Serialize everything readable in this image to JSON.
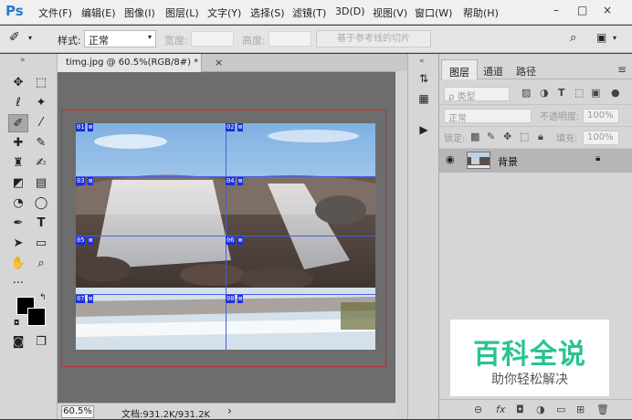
{
  "menubar": {
    "logo": "Ps",
    "items": [
      "文件(F)",
      "编辑(E)",
      "图像(I)",
      "图层(L)",
      "文字(Y)",
      "选择(S)",
      "滤镜(T)",
      "3D(D)",
      "视图(V)",
      "窗口(W)",
      "帮助(H)"
    ],
    "window_buttons": [
      "–",
      "□",
      "×"
    ]
  },
  "options": {
    "style_label": "样式:",
    "style_value": "正常",
    "width_label": "宽度:",
    "height_label": "高度:",
    "refine_button": "基于参考线的切片"
  },
  "document": {
    "tab_title": "timg.jpg @ 60.5%(RGB/8#) *",
    "close_glyph": "×",
    "slice_labels": [
      "01",
      "02",
      "03",
      "04",
      "05",
      "06",
      "07",
      "08"
    ]
  },
  "status": {
    "zoom": "60.5%",
    "doc_info": "文档:931.2K/931.2K",
    "arrow": "›"
  },
  "layers_panel": {
    "tabs": [
      "图层",
      "通道",
      "路径"
    ],
    "filter_placeholder": "ρ 类型",
    "blend_mode": "正常",
    "opacity_label": "不透明度:",
    "opacity_value": "100%",
    "lock_label": "锁定:",
    "fill_label": "填充:",
    "fill_value": "100%",
    "layer_name": "背景"
  },
  "watermark": {
    "title": "百科全说",
    "subtitle": "助你轻松解决"
  },
  "colors": {
    "accent": "#2a7ad3",
    "slice_blue": "#1d2fd6",
    "canvas_border": "#b93131",
    "watermark_green": "#29c48f"
  }
}
